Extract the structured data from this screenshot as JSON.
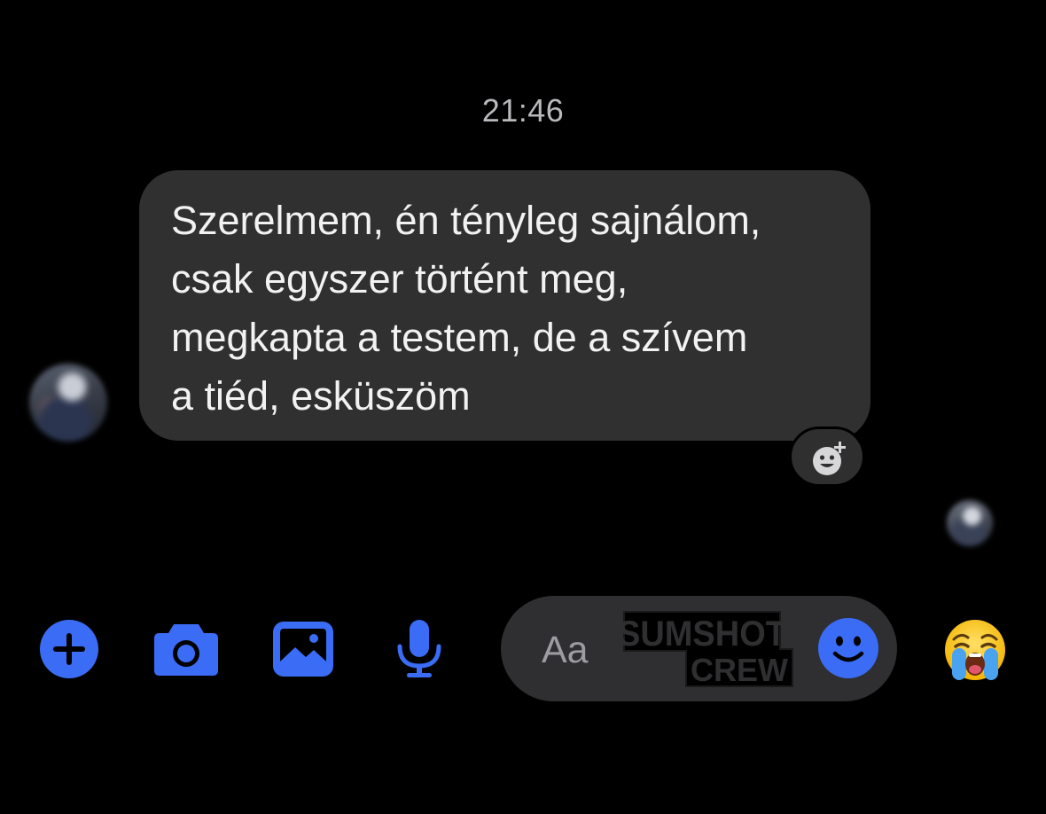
{
  "chat": {
    "timestamp": "21:46",
    "message_text": "Szerelmem, én tényleg sajnálom,\ncsak egyszer történt meg,\nmegkapta a testem, de a szívem\na tiéd, esküszöm"
  },
  "composer": {
    "placeholder": "Aa"
  },
  "watermark": {
    "text_line1": "SUMSHOT",
    "text_line2": "CREW"
  },
  "icons": {
    "add": "plus-circle-icon",
    "camera": "camera-icon",
    "gallery": "image-icon",
    "microphone": "microphone-icon",
    "reaction": "add-reaction-icon",
    "emoji": "smiley-icon",
    "quick_reaction": "crying-face-emoji"
  },
  "colors": {
    "accent": "#3b6cf6",
    "bubble": "#303030",
    "background": "#000000"
  }
}
